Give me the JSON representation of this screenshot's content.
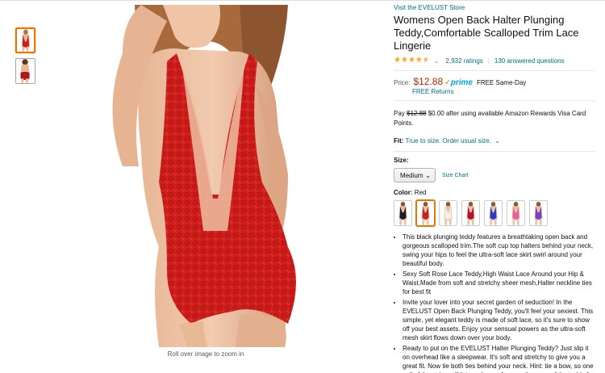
{
  "product": {
    "store_link": "Visit the EVELUST Store",
    "title": "Womens Open Back Halter Plunging Teddy,Comfortable Scalloped Trim Lace Lingerie",
    "rating_stars": 4.5,
    "ratings_count": "2,932 ratings",
    "answered_questions": "130 answered questions",
    "price_label": "Price:",
    "price": "$12.88",
    "prime_label": "prime",
    "shipping": "FREE Same-Day",
    "free_returns": "FREE Returns",
    "pay_prefix": "Pay",
    "pay_strike": "$12.88",
    "pay_suffix": "$0.00 after using available Amazon Rewards Visa Card Points.",
    "fit_label": "Fit:",
    "fit_value": "True to size. Order usual size.",
    "size_label": "Size:",
    "size_selected": "Medium",
    "size_chart": "Size Chart",
    "color_label": "Color:",
    "color_selected": "Red",
    "zoom_hint": "Roll over image to zoom in",
    "bullets": [
      "This black plunging teddy features a breathtaking open back and gorgeous scalloped trim.The soft cup top halters behind your neck, swing your hips to feel the ultra-soft lace skirt swirl around your beautiful body.",
      "Sexy Soft Rose Lace Teddy,High Waist Lace Around your Hip & Waist,Made from soft and stretchy sheer mesh,Halter neckline ties for best fit",
      "Invite your lover into your secret garden of seduction! In the EVELUST Open Back Plunging Teddy, you'll feel your sexiest. This simple, yet elegant teddy is made of soft lace, so it's sure to show off your best assets. Enjoy your sensual powers as the ultra-soft mesh skirt flows down over your body.",
      "Ready to put on the EVELUST Halter Plunging Teddy? Just slip it on overhead like a sleepwear. It's soft and stretchy to give you a great fit. Now tie both ties behind your neck. Hint: tie a bow, so one pull of the string will let you loose. Arrange the cups of the teddy for"
    ]
  },
  "thumbnails": [
    {
      "name": "thumb-front",
      "color": "#c8201e",
      "active": true
    },
    {
      "name": "thumb-back",
      "color": "#b01818",
      "active": false
    }
  ],
  "swatches": [
    {
      "color": "#1c1c2e",
      "skin": "#e9c3a6",
      "active": false
    },
    {
      "color": "#c8201e",
      "skin": "#e9c3a6",
      "active": true
    },
    {
      "color": "#f1eeee",
      "skin": "#e9c3a6",
      "active": false
    },
    {
      "color": "#b3122a",
      "skin": "#e9c3a6",
      "active": false
    },
    {
      "color": "#2a3cc4",
      "skin": "#e9c3a6",
      "active": false
    },
    {
      "color": "#e7609a",
      "skin": "#e9c3a6",
      "active": false
    },
    {
      "color": "#7a3fc1",
      "skin": "#e9c3a6",
      "active": false
    }
  ],
  "colors": {
    "link": "#007185",
    "price": "#b12704",
    "star": "#ffa41c",
    "selected_border": "#e77600"
  }
}
